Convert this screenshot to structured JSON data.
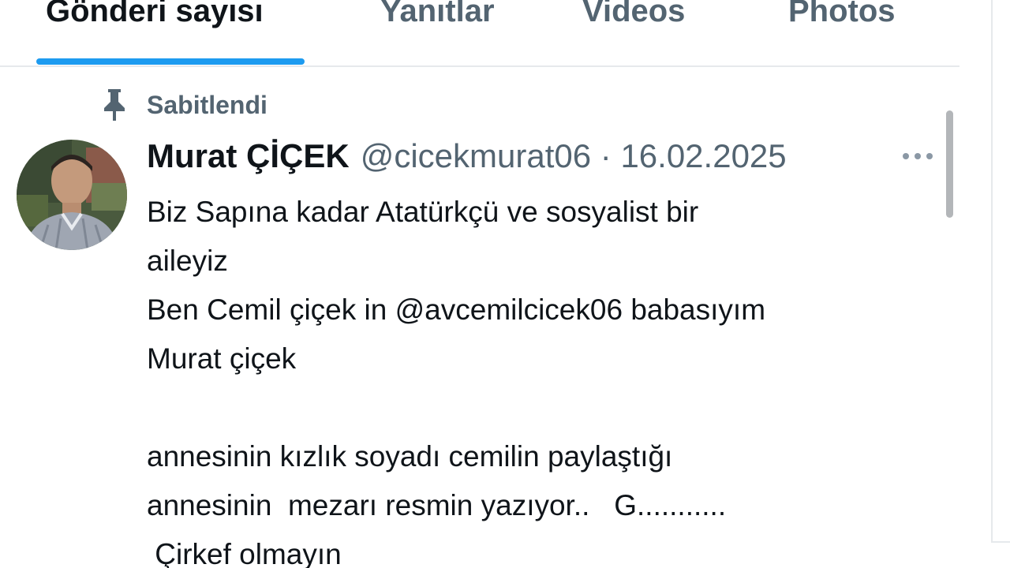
{
  "tabs": [
    {
      "label": "Gönderi sayısı",
      "active": true
    },
    {
      "label": "Yanıtlar",
      "active": false
    },
    {
      "label": "Videos",
      "active": false
    },
    {
      "label": "Photos",
      "active": false
    }
  ],
  "pinned": {
    "icon": "pin-icon",
    "label": "Sabitlendi"
  },
  "tweet": {
    "avatar_icon": "avatar",
    "display_name": "Murat ÇİÇEK",
    "handle": "@cicekmurat06",
    "separator": "·",
    "date": "16.02.2025",
    "more_icon": "more-icon",
    "lines": [
      "Biz Sapına kadar Atatürkçü ve sosyalist bir",
      "aileyiz",
      "Ben Cemil çiçek in @avcemilcicek06 babasıyım",
      "Murat çiçek",
      "",
      "annesinin kızlık soyadı cemilin paylaştığı",
      "annesinin  mezarı resmin yazıyor..   G...........",
      " Çirkef olmayın"
    ]
  },
  "colors": {
    "accent": "#1d9bf0",
    "text_primary": "#0f1419",
    "text_secondary": "#536471",
    "divider": "#e6e9ec"
  }
}
